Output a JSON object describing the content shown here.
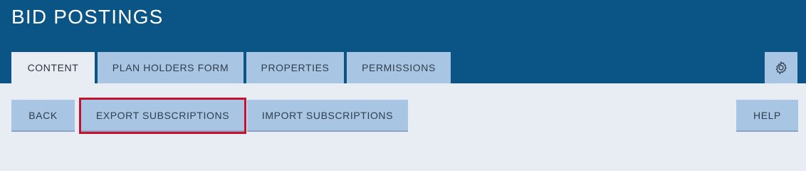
{
  "header": {
    "title": "BID POSTINGS",
    "settings_icon": "gear-icon"
  },
  "tabs": [
    {
      "label": "CONTENT",
      "active": true
    },
    {
      "label": "PLAN HOLDERS FORM",
      "active": false
    },
    {
      "label": "PROPERTIES",
      "active": false
    },
    {
      "label": "PERMISSIONS",
      "active": false
    }
  ],
  "toolbar": {
    "back_label": "BACK",
    "export_label": "EXPORT SUBSCRIPTIONS",
    "import_label": "IMPORT SUBSCRIPTIONS",
    "help_label": "HELP"
  },
  "colors": {
    "header_bg": "#0b5486",
    "button_bg": "#a8c5e3",
    "content_bg": "#e8edf3",
    "highlight": "#c4122f"
  }
}
